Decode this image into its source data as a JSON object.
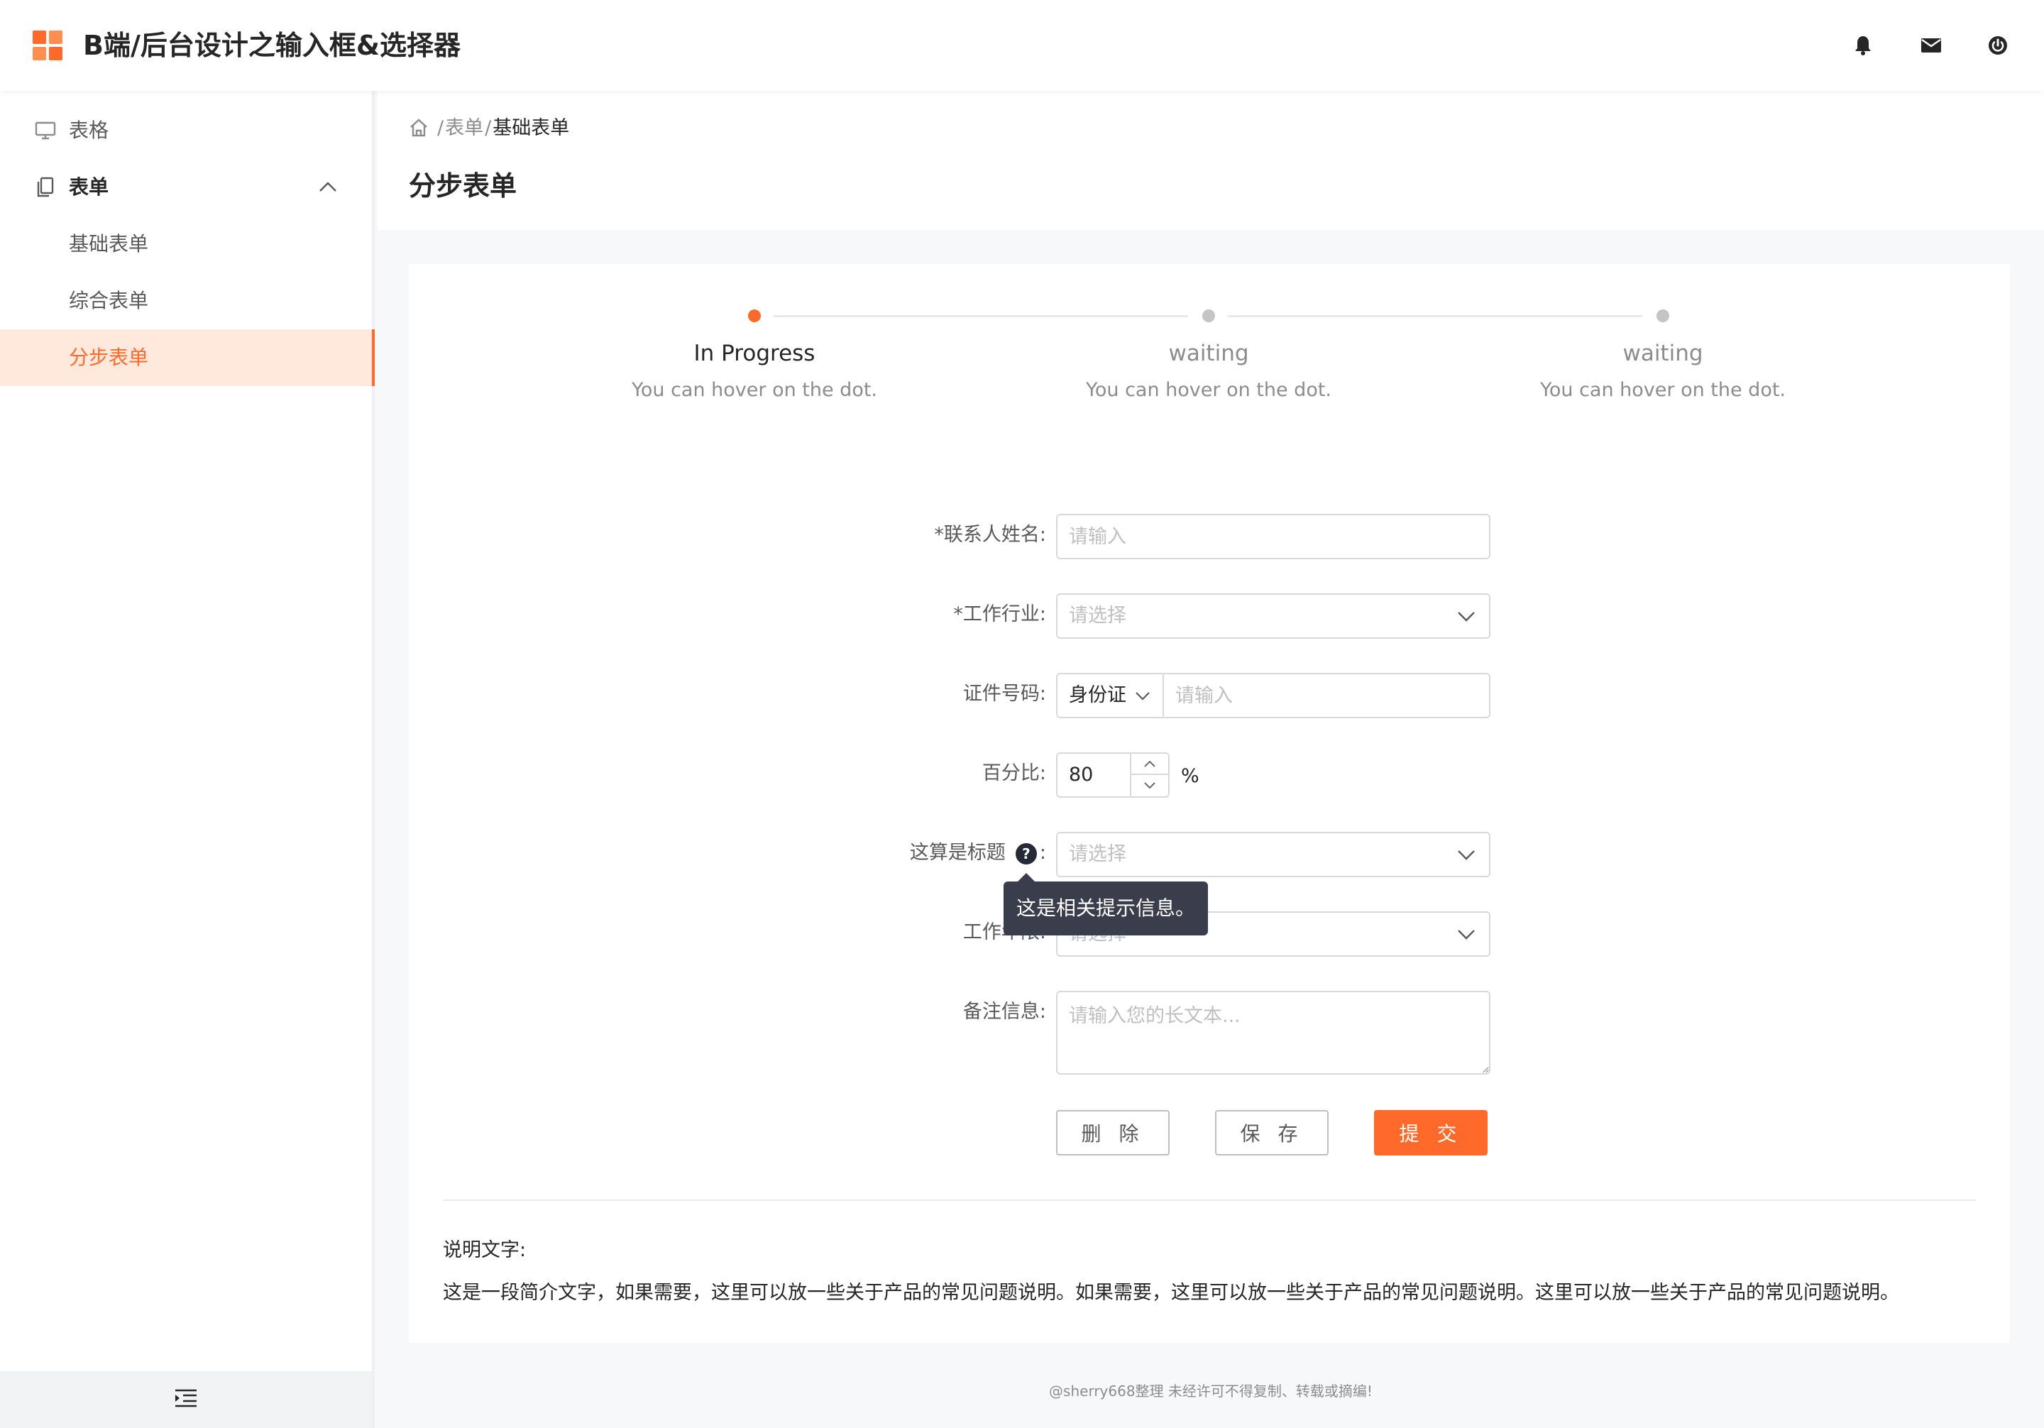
{
  "app": {
    "title": "B端/后台设计之输入框&选择器"
  },
  "header": {
    "icons": [
      {
        "name": "bell-icon"
      },
      {
        "name": "mail-icon"
      },
      {
        "name": "power-icon"
      }
    ]
  },
  "sidebar": {
    "items": [
      {
        "label": "表格",
        "icon": "monitor-icon"
      },
      {
        "label": "表单",
        "icon": "copy-icon",
        "expanded": true
      },
      {
        "label": "基础表单"
      },
      {
        "label": "综合表单"
      },
      {
        "label": "分步表单",
        "active": true
      }
    ],
    "collapse_icon": "menu-collapse-icon"
  },
  "breadcrumb": {
    "sep1": "/",
    "item1": "表单",
    "sep2": "/",
    "current": "基础表单"
  },
  "page": {
    "title": "分步表单"
  },
  "steps": [
    {
      "title": "In Progress",
      "desc": "You can hover on the dot.",
      "status": "process"
    },
    {
      "title": "waiting",
      "desc": "You can hover on the dot.",
      "status": "wait"
    },
    {
      "title": "waiting",
      "desc": "You can hover on the dot.",
      "status": "wait"
    }
  ],
  "form": {
    "contact_label": "*联系人姓名:",
    "contact_placeholder": "请输入",
    "industry_label": "*工作行业:",
    "industry_placeholder": "请选择",
    "id_label": "证件号码:",
    "id_type": "身份证",
    "id_placeholder": "请输入",
    "percent_label": "百分比:",
    "percent_value": "80",
    "percent_unit": "%",
    "title_label": "这算是标题",
    "title_help": "?",
    "title_colon": ":",
    "title_placeholder": "请选择",
    "tooltip": "这是相关提示信息。",
    "years_label": "工作年限:",
    "years_placeholder": "请选择",
    "remark_label": "备注信息:",
    "remark_placeholder": "请输入您的长文本..."
  },
  "buttons": {
    "delete": "删 除",
    "save": "保 存",
    "submit": "提 交"
  },
  "note": {
    "title": "说明文字:",
    "body": "这是一段简介文字，如果需要，这里可以放一些关于产品的常见问题说明。如果需要，这里可以放一些关于产品的常见问题说明。这里可以放一些关于产品的常见问题说明。"
  },
  "footer": {
    "text": "@sherry668整理  未经许可不得复制、转载或摘编!"
  },
  "colors": {
    "accent": "#ff6a2a",
    "active_bg": "#ffe9dc",
    "tooltip_bg": "#3a3e4c"
  }
}
